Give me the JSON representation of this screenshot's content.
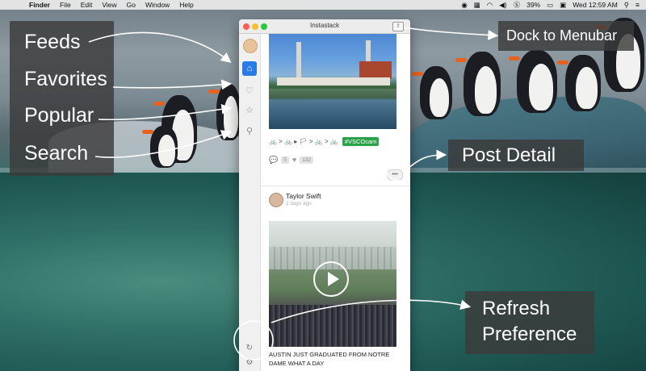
{
  "menubar": {
    "apple": "",
    "items": [
      "Finder",
      "File",
      "Edit",
      "View",
      "Go",
      "Window",
      "Help"
    ],
    "battery": "39%",
    "clock": "Wed 12:59 AM"
  },
  "window": {
    "title": "Instastack",
    "dock_button_icon": "dock-to-menubar-icon"
  },
  "sidebar": {
    "items": [
      {
        "name": "feeds",
        "icon": "home-icon"
      },
      {
        "name": "favorites",
        "icon": "heart-icon"
      },
      {
        "name": "popular",
        "icon": "star-icon"
      },
      {
        "name": "search",
        "icon": "search-icon"
      }
    ],
    "bottom": [
      "refresh-icon",
      "preference-icon"
    ]
  },
  "post1": {
    "caption_emoji": "🚲 > 🚲 ▸ 🏳 > 🚲 > 🚲",
    "hashtag": "#VSCOcam",
    "comments": "5",
    "likes": "132",
    "more": "•••"
  },
  "post2": {
    "author": "Taylor Swift",
    "time": "2 days ago",
    "caption": "AUSTIN JUST GRADUATED FROM NOTRE DAME WHAT A DAY"
  },
  "annotations": {
    "feeds": "Feeds",
    "favorites": "Favorites",
    "popular": "Popular",
    "search": "Search",
    "dock": "Dock to Menubar",
    "post_detail": "Post Detail",
    "refresh": "Refresh",
    "preference": "Preference"
  },
  "colors": {
    "accent": "#2a7be8",
    "hashtag_bg": "#2aa24a",
    "label_bg": "#3a3a3a"
  }
}
